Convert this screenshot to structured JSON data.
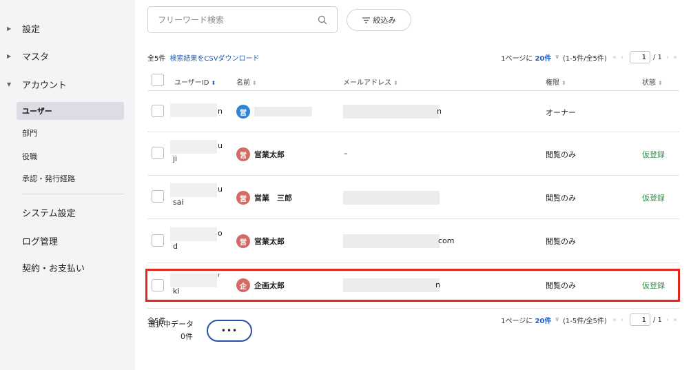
{
  "sidebar": {
    "groups": [
      {
        "label": "設定",
        "arrow": "▶"
      },
      {
        "label": "マスタ",
        "arrow": "▶"
      },
      {
        "label": "アカウント",
        "arrow": "▼"
      }
    ],
    "account_items": [
      {
        "label": "ユーザー",
        "active": true
      },
      {
        "label": "部門"
      },
      {
        "label": "役職"
      },
      {
        "label": "承認・発行経路"
      }
    ],
    "items": [
      {
        "label": "システム設定"
      },
      {
        "label": "ログ管理"
      },
      {
        "label": "契約・お支払い"
      }
    ]
  },
  "search": {
    "placeholder": "フリーワード検索",
    "value": "",
    "icon": "search-icon"
  },
  "filter": {
    "label": "絞込み",
    "icon": "filter-icon"
  },
  "pager_top": {
    "total": "全5件",
    "csv_link": "検索結果をCSVダウンロード",
    "per_page_prefix": "1ページに",
    "per_page_value": "20件",
    "range": "(1-5件/全5件)",
    "page": "1",
    "page_of": "/ 1"
  },
  "table": {
    "headers": {
      "user_id": "ユーザーID",
      "name": "名前",
      "email": "メールアドレス",
      "role": "権限",
      "status": "状態"
    },
    "rows": [
      {
        "uid_tail": "n",
        "uid_line2": "",
        "avatar": "営",
        "avatar_color": "#2f86d6",
        "name": "",
        "email_tail": "n",
        "role": "オーナー",
        "status": ""
      },
      {
        "uid_tail": "u",
        "uid_line2": "ji",
        "avatar": "営",
        "avatar_color": "#d26b66",
        "name": "営業太郎",
        "email_text": "–",
        "role": "閲覧のみ",
        "status": "仮登録"
      },
      {
        "uid_tail": "u",
        "uid_line2": "sai",
        "avatar": "営",
        "avatar_color": "#d26b66",
        "name": "営業　三郎",
        "email_tail": "",
        "role": "閲覧のみ",
        "status": "仮登録"
      },
      {
        "uid_tail": "o",
        "uid_line2": "d",
        "avatar": "営",
        "avatar_color": "#d26b66",
        "name": "営業太郎",
        "email_tail": "com",
        "role": "閲覧のみ",
        "status": ""
      },
      {
        "uid_tail": "r",
        "uid_line2": "ki",
        "avatar": "企",
        "avatar_color": "#d26b66",
        "name": "企画太郎",
        "email_tail": "n",
        "role": "閲覧のみ",
        "status": "仮登録"
      }
    ]
  },
  "pager_bottom": {
    "total": "全5件",
    "per_page_prefix": "1ページに",
    "per_page_value": "20件",
    "range": "(1-5件/全5件)",
    "page": "1",
    "page_of": "/ 1"
  },
  "selection": {
    "label": "選択中データ",
    "count": "0件",
    "more_label": "•••"
  },
  "colors": {
    "accent": "#1f5fbf",
    "status_green": "#3a8f4e",
    "highlight": "#e3261f",
    "owner_avatar": "#2f86d6",
    "member_avatar": "#d26b66"
  }
}
